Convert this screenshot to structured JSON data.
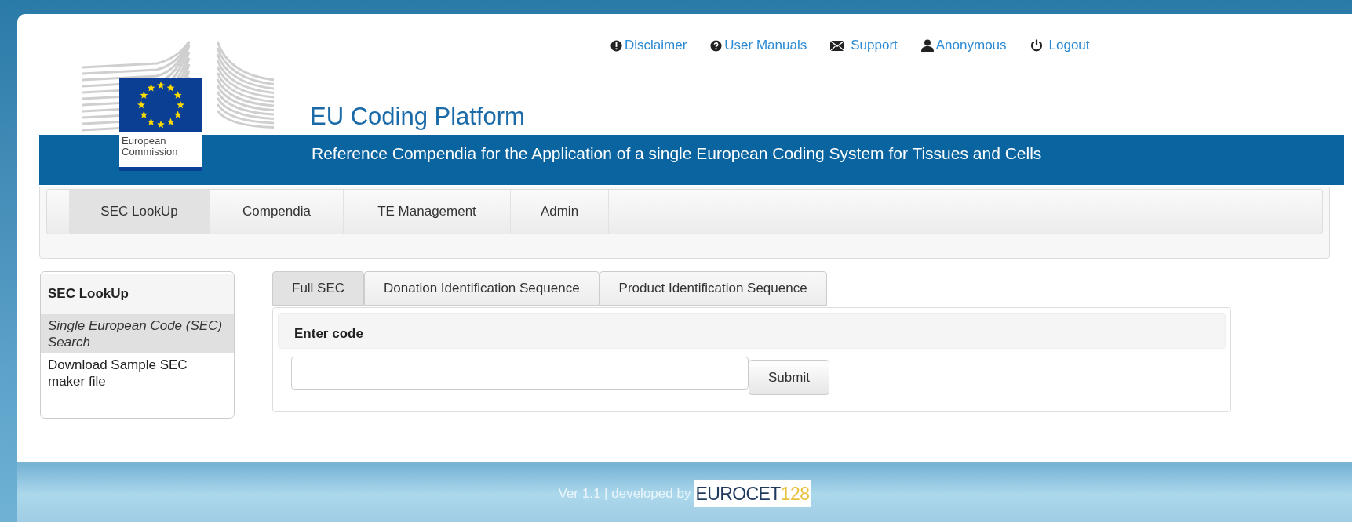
{
  "logo": {
    "text": [
      "European",
      "Commission"
    ]
  },
  "top_links": [
    {
      "kind": "alert",
      "label": "Disclaimer"
    },
    {
      "kind": "help",
      "label": "User Manuals"
    },
    {
      "kind": "mail",
      "label": "Support"
    },
    {
      "kind": "user",
      "label": "Anonymous"
    },
    {
      "kind": "power",
      "label": "Logout"
    }
  ],
  "title": "EU Coding Platform",
  "subtitle": "Reference Compendia for the Application of a single European Coding System for Tissues and Cells",
  "nav": [
    {
      "label": "SEC LookUp",
      "selected": true
    },
    {
      "label": "Compendia",
      "selected": false
    },
    {
      "label": "TE Management",
      "selected": false
    },
    {
      "label": "Admin",
      "selected": false
    }
  ],
  "sidebar": {
    "heading": "SEC LookUp",
    "items": [
      {
        "label": "Single European Code (SEC) Search",
        "selected": true
      },
      {
        "label": "Download Sample SEC maker file",
        "selected": false
      }
    ]
  },
  "tabs": [
    {
      "label": "Full SEC",
      "selected": true
    },
    {
      "label": "Donation Identification Sequence",
      "selected": false
    },
    {
      "label": "Product Identification Sequence",
      "selected": false
    }
  ],
  "panel": {
    "heading": "Enter code",
    "button": "Submit"
  },
  "footer": {
    "text": "Ver 1.1 | developed by",
    "logo_main": "EUROCET",
    "logo_num": "128"
  }
}
